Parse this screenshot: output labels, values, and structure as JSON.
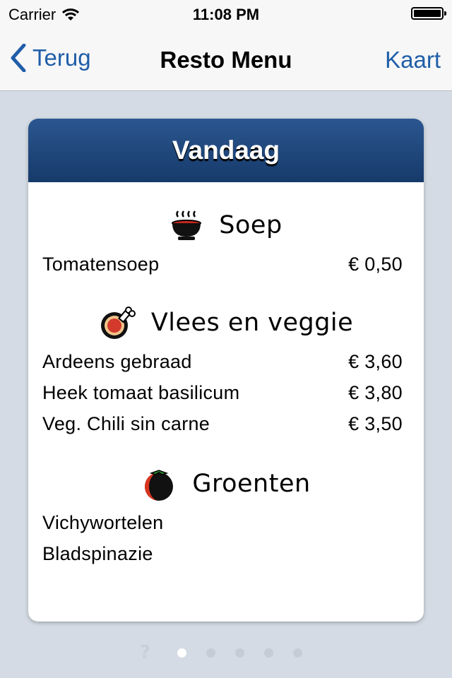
{
  "status": {
    "carrier": "Carrier",
    "time": "11:08 PM"
  },
  "nav": {
    "back_label": "Terug",
    "title": "Resto Menu",
    "right_label": "Kaart"
  },
  "card": {
    "title": "Vandaag"
  },
  "sections": [
    {
      "title": "Soep",
      "icon": "soup-bowl-icon",
      "items": [
        {
          "name": "Tomatensoep",
          "price": "€ 0,50"
        }
      ]
    },
    {
      "title": "Vlees en veggie",
      "icon": "meat-drumstick-icon",
      "items": [
        {
          "name": "Ardeens gebraad",
          "price": "€ 3,60"
        },
        {
          "name": "Heek tomaat basilicum",
          "price": "€ 3,80"
        },
        {
          "name": "Veg. Chili sin carne",
          "price": "€ 3,50"
        }
      ]
    },
    {
      "title": "Groenten",
      "icon": "tomato-icon",
      "items": [
        {
          "name": "Vichywortelen",
          "price": ""
        },
        {
          "name": "Bladspinazie",
          "price": ""
        }
      ]
    }
  ],
  "pager": {
    "help_symbol": "?",
    "page_count": 5,
    "active_page": 1
  },
  "colors": {
    "accent": "#1f5ea8",
    "header_top": "#2b5690",
    "header_bottom": "#163a6a",
    "background": "#d4dbe4"
  }
}
